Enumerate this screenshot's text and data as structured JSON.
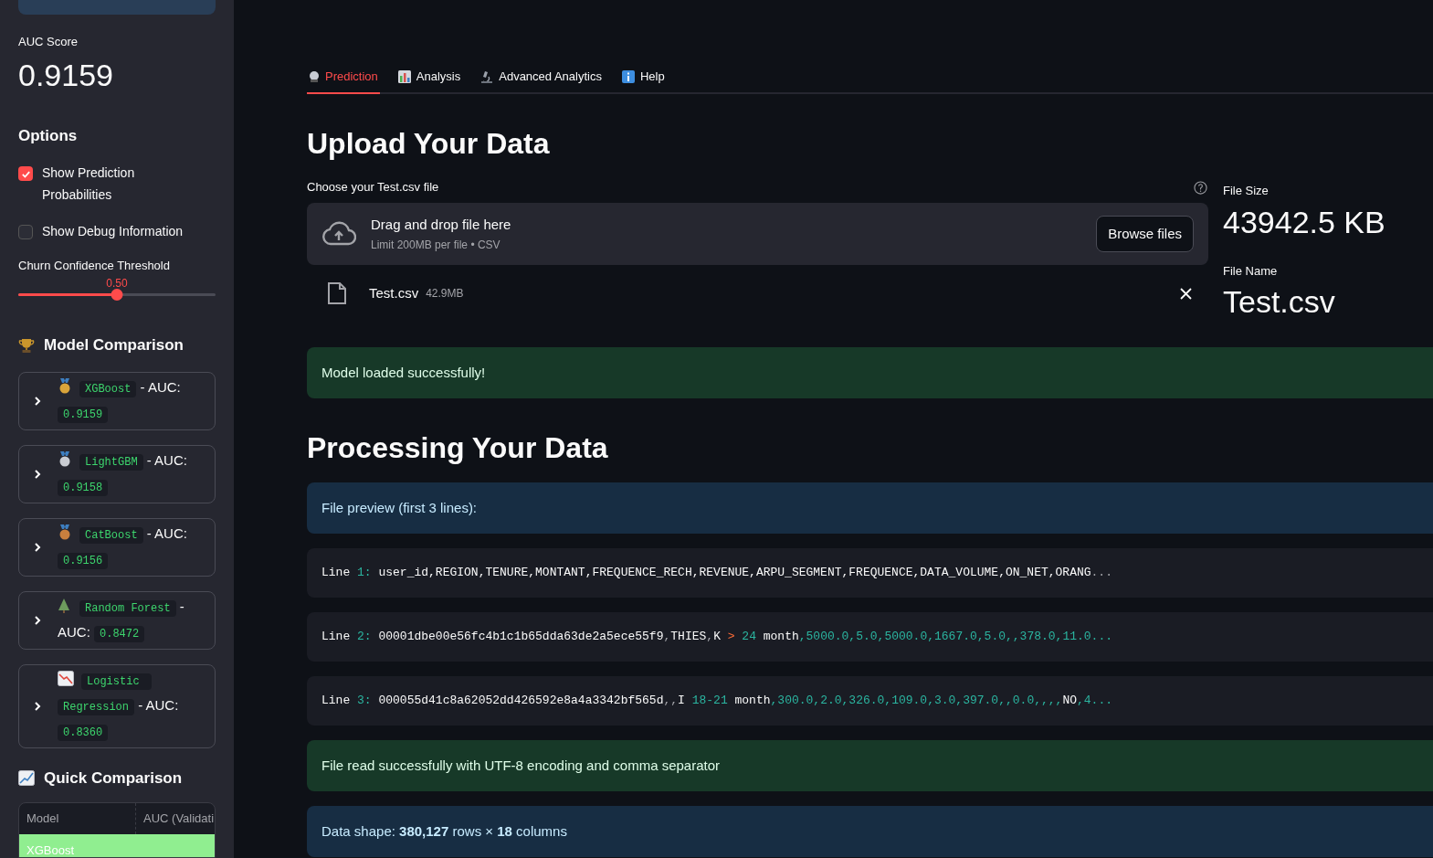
{
  "sidebar": {
    "metric": {
      "label": "AUC Score",
      "value": "0.9159"
    },
    "options": {
      "title": "Options",
      "checkboxes": [
        {
          "label": "Show Prediction Probabilities",
          "checked": true
        },
        {
          "label": "Show Debug Information",
          "checked": false
        }
      ]
    },
    "slider": {
      "label": "Churn Confidence Threshold",
      "reading": "0.50",
      "level": 0.5
    },
    "model_comparison": {
      "title": "Model Comparison",
      "models": [
        {
          "name": "XGBoost",
          "suffix": "- AUC:",
          "auc": "0.9159",
          "expanded": false
        },
        {
          "name": "LightGBM",
          "suffix": "- AUC:",
          "auc": "0.9158",
          "expanded": false
        },
        {
          "name": "CatBoost",
          "suffix": "- AUC:",
          "auc": "0.9156",
          "expanded": false
        },
        {
          "name": "Random Forest",
          "suffix": "- AUC:",
          "auc": "0.8472",
          "expanded": false
        },
        {
          "name": "Logistic Regression",
          "suffix": "- AUC:",
          "auc": "0.8360",
          "expanded": false
        }
      ]
    },
    "quick_comparison": {
      "title": "Quick Comparison",
      "columns": [
        "Model",
        "AUC (Validati"
      ],
      "rows": [
        [
          "XGBoost"
        ]
      ]
    }
  },
  "tabs": [
    {
      "label": "Prediction",
      "selected": true
    },
    {
      "label": "Analysis",
      "selected": false
    },
    {
      "label": "Advanced Analytics",
      "selected": false
    },
    {
      "label": "Help",
      "selected": false
    }
  ],
  "upload": {
    "title": "Upload Your Data",
    "label": "Choose your Test.csv file",
    "drop_title": "Drag and drop file here",
    "drop_hint": "Limit 200MB per file • CSV",
    "button": "Browse files",
    "file": {
      "name": "Test.csv",
      "size": "42.9MB"
    }
  },
  "file_info": [
    {
      "label": "File Size",
      "value": "43942.5 KB"
    },
    {
      "label": "File Name",
      "value": "Test.csv"
    }
  ],
  "model_status": {
    "kind": "success",
    "text": "Model loaded successfully!"
  },
  "processing": {
    "title": "Processing Your Data",
    "messages": [
      {
        "kind": "info",
        "text": "File preview (first 3 lines):"
      }
    ],
    "lines": [
      {
        "label": "Line",
        "number": "1:",
        "segments": [
          {
            "kind": "text",
            "text": "user_id,REGION,TENURE,MONTANT,FREQUENCE_RECH,REVENUE,ARPU_SEGMENT,FREQUENCE,DATA_VOLUME,ON_NET,ORANG"
          },
          {
            "kind": "punct",
            "text": "..."
          }
        ]
      },
      {
        "label": "Line",
        "number": "2:",
        "segments": [
          {
            "kind": "text",
            "text": "00001dbe00e56fc4b1c1b65dda63de2a5ece55f9"
          },
          {
            "kind": "punct",
            "text": ","
          },
          {
            "kind": "text",
            "text": "THIES"
          },
          {
            "kind": "punct",
            "text": ","
          },
          {
            "kind": "text",
            "text": "K"
          },
          {
            "kind": "operator",
            "text": " > "
          },
          {
            "kind": "number",
            "text": "24"
          },
          {
            "kind": "text",
            "text": " month"
          },
          {
            "kind": "number",
            "text": ",5000.0,5.0,5000.0,1667.0,5.0,,378.0,11.0..."
          }
        ]
      },
      {
        "label": "Line",
        "number": "3:",
        "segments": [
          {
            "kind": "text",
            "text": "000055d41c8a62052dd426592e8a4a3342bf565d"
          },
          {
            "kind": "punct",
            "text": ",,"
          },
          {
            "kind": "text",
            "text": "I"
          },
          {
            "kind": "number",
            "text": " 18-21"
          },
          {
            "kind": "text",
            "text": " month"
          },
          {
            "kind": "number",
            "text": ",300.0,2.0,326.0,109.0,3.0,397.0,,0.0,,,,"
          },
          {
            "kind": "text",
            "text": "NO"
          },
          {
            "kind": "number",
            "text": ",4..."
          }
        ]
      }
    ],
    "results": [
      {
        "kind": "success",
        "text": "File read successfully with UTF-8 encoding and comma separator"
      },
      {
        "kind": "info",
        "text": "Data shape: **380,127** rows × **18** columns"
      }
    ]
  }
}
